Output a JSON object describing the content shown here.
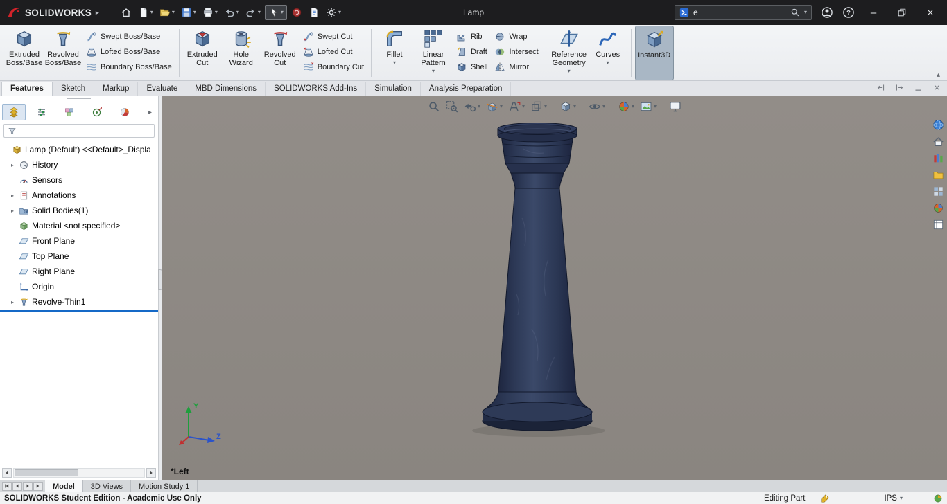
{
  "titlebar": {
    "brand": "SOLIDWORKS",
    "brand_accent": "#d2232a",
    "document_title": "Lamp",
    "search": {
      "value": "e"
    },
    "tools": [
      {
        "icon": "home",
        "caret": false
      },
      {
        "icon": "new-document",
        "caret": true
      },
      {
        "icon": "open",
        "caret": true
      },
      {
        "icon": "save",
        "caret": true
      },
      {
        "icon": "print",
        "caret": true
      },
      {
        "icon": "undo",
        "caret": true
      },
      {
        "icon": "redo",
        "caret": true
      },
      {
        "icon": "select-cursor",
        "caret": true,
        "boxed": true
      },
      {
        "icon": "rebuild",
        "caret": false
      },
      {
        "icon": "file-properties",
        "caret": false
      },
      {
        "icon": "options-gear",
        "caret": true
      }
    ]
  },
  "ribbon": {
    "groups": [
      {
        "items": [
          {
            "type": "large",
            "lines": [
              "Extruded",
              "Boss/Base"
            ],
            "icon": "extruded-boss",
            "caret": false
          },
          {
            "type": "large",
            "lines": [
              "Revolved",
              "Boss/Base"
            ],
            "icon": "revolved-boss",
            "caret": false
          },
          {
            "type": "stack",
            "rows": [
              {
                "label": "Swept Boss/Base",
                "icon": "swept-boss"
              },
              {
                "label": "Lofted Boss/Base",
                "icon": "lofted-boss"
              },
              {
                "label": "Boundary Boss/Base",
                "icon": "boundary-boss"
              }
            ]
          }
        ]
      },
      {
        "items": [
          {
            "type": "large",
            "lines": [
              "Extruded",
              "Cut"
            ],
            "icon": "extruded-cut",
            "caret": false
          },
          {
            "type": "large",
            "lines": [
              "Hole",
              "Wizard"
            ],
            "icon": "hole-wizard",
            "caret": false
          },
          {
            "type": "large",
            "lines": [
              "Revolved",
              "Cut"
            ],
            "icon": "revolved-cut",
            "caret": false
          },
          {
            "type": "stack",
            "rows": [
              {
                "label": "Swept Cut",
                "icon": "swept-cut"
              },
              {
                "label": "Lofted Cut",
                "icon": "lofted-cut"
              },
              {
                "label": "Boundary Cut",
                "icon": "boundary-cut"
              }
            ]
          }
        ]
      },
      {
        "items": [
          {
            "type": "large",
            "lines": [
              "Fillet"
            ],
            "icon": "fillet",
            "caret": true
          },
          {
            "type": "large",
            "lines": [
              "Linear",
              "Pattern"
            ],
            "icon": "linear-pattern",
            "caret": true
          },
          {
            "type": "stack",
            "rows": [
              {
                "label": "Rib",
                "icon": "rib"
              },
              {
                "label": "Draft",
                "icon": "draft"
              },
              {
                "label": "Shell",
                "icon": "shell"
              }
            ]
          },
          {
            "type": "stack",
            "rows": [
              {
                "label": "Wrap",
                "icon": "wrap"
              },
              {
                "label": "Intersect",
                "icon": "intersect"
              },
              {
                "label": "Mirror",
                "icon": "mirror"
              }
            ]
          }
        ]
      },
      {
        "items": [
          {
            "type": "large",
            "lines": [
              "Reference",
              "Geometry"
            ],
            "icon": "reference-geometry",
            "caret": true
          },
          {
            "type": "large",
            "lines": [
              "Curves"
            ],
            "icon": "curves",
            "caret": true
          }
        ]
      },
      {
        "items": [
          {
            "type": "large",
            "lines": [
              "Instant3D"
            ],
            "icon": "instant3d",
            "caret": false,
            "active": true
          }
        ]
      }
    ],
    "collapse_glyph": "▴"
  },
  "command_tabs": {
    "tabs": [
      {
        "label": "Features",
        "active": true
      },
      {
        "label": "Sketch"
      },
      {
        "label": "Markup"
      },
      {
        "label": "Evaluate"
      },
      {
        "label": "MBD Dimensions"
      },
      {
        "label": "SOLIDWORKS Add-Ins"
      },
      {
        "label": "Simulation"
      },
      {
        "label": "Analysis Preparation"
      }
    ],
    "controls": [
      "dock-left",
      "dock-right",
      "minimize-panel",
      "close-panel"
    ]
  },
  "feature_tree": {
    "manager_tabs": [
      "featuremanager",
      "propertymanager",
      "configurationmanager",
      "dimxpertmanager",
      "displaymanager"
    ],
    "active_manager_tab": 0,
    "filter_value": "",
    "items": [
      {
        "label": "Lamp (Default) <<Default>_Displa",
        "icon": "part",
        "arrow": false,
        "level": 0
      },
      {
        "label": "History",
        "icon": "history",
        "arrow": true,
        "level": 1
      },
      {
        "label": "Sensors",
        "icon": "sensors",
        "arrow": false,
        "level": 1
      },
      {
        "label": "Annotations",
        "icon": "annotations",
        "arrow": true,
        "level": 1
      },
      {
        "label": "Solid Bodies(1)",
        "icon": "solid-bodies",
        "arrow": true,
        "level": 1
      },
      {
        "label": "Material <not specified>",
        "icon": "material",
        "arrow": false,
        "level": 1
      },
      {
        "label": "Front Plane",
        "icon": "plane",
        "arrow": false,
        "level": 1
      },
      {
        "label": "Top Plane",
        "icon": "plane",
        "arrow": false,
        "level": 1
      },
      {
        "label": "Right Plane",
        "icon": "plane",
        "arrow": false,
        "level": 1
      },
      {
        "label": "Origin",
        "icon": "origin",
        "arrow": false,
        "level": 1
      },
      {
        "label": "Revolve-Thin1",
        "icon": "revolve-thin",
        "arrow": true,
        "level": 1,
        "rollback_after": true
      }
    ]
  },
  "viewport": {
    "view_label": "*Left",
    "triad": {
      "y_label": "Y",
      "z_label": "Z"
    },
    "model_colors": {
      "body": "#2e3a57",
      "edge": "#12192c"
    },
    "headsup": [
      {
        "icon": "zoom-to-fit",
        "caret": false
      },
      {
        "icon": "zoom-to-area",
        "caret": false
      },
      {
        "icon": "previous-view",
        "caret": true
      },
      {
        "icon": "section-view",
        "caret": true
      },
      {
        "icon": "annotation-views",
        "caret": true
      },
      {
        "icon": "view-orientation",
        "caret": true
      },
      {
        "icon": "display-style",
        "caret": true,
        "gap": true
      },
      {
        "icon": "hide-show-items",
        "caret": true,
        "gap": true
      },
      {
        "icon": "edit-appearance",
        "caret": true,
        "gap": true
      },
      {
        "icon": "apply-scene",
        "caret": true
      },
      {
        "icon": "view-settings",
        "caret": false,
        "gap": true
      }
    ]
  },
  "task_pane": {
    "icons": [
      "navigation-sphere",
      "home-pane",
      "design-library",
      "file-explorer",
      "view-palette",
      "appearances",
      "custom-properties"
    ]
  },
  "document_tabs": {
    "nav": [
      "nav-first",
      "nav-prev",
      "nav-next",
      "nav-last"
    ],
    "tabs": [
      {
        "label": "Model",
        "active": true
      },
      {
        "label": "3D Views"
      },
      {
        "label": "Motion Study 1"
      }
    ]
  },
  "statusbar": {
    "message": "SOLIDWORKS Student Edition - Academic Use Only",
    "editing_status": "Editing Part",
    "units": "IPS"
  }
}
